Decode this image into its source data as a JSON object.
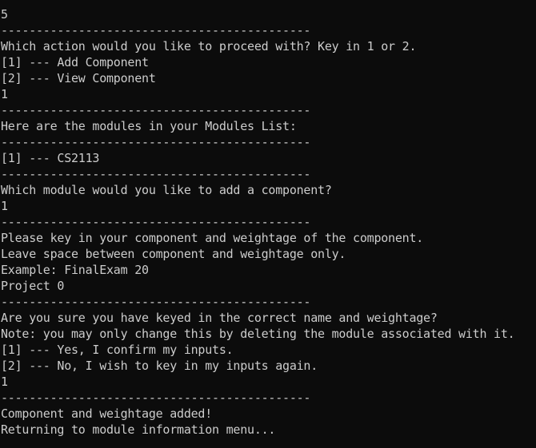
{
  "console": {
    "lines": [
      "5",
      "--------------------------------------------",
      "Which action would you like to proceed with? Key in 1 or 2.",
      "[1] --- Add Component",
      "[2] --- View Component",
      "1",
      "--------------------------------------------",
      "Here are the modules in your Modules List:",
      "--------------------------------------------",
      "[1] --- CS2113",
      "--------------------------------------------",
      "Which module would you like to add a component?",
      "1",
      "--------------------------------------------",
      "Please key in your component and weightage of the component.",
      "Leave space between component and weightage only.",
      "Example: FinalExam 20",
      "Project 0",
      "--------------------------------------------",
      "Are you sure you have keyed in the correct name and weightage?",
      "Note: you may only change this by deleting the module associated with it.",
      "[1] --- Yes, I confirm my inputs.",
      "[2] --- No, I wish to key in my inputs again.",
      "1",
      "--------------------------------------------",
      "Component and weightage added!",
      "Returning to module information menu..."
    ]
  }
}
